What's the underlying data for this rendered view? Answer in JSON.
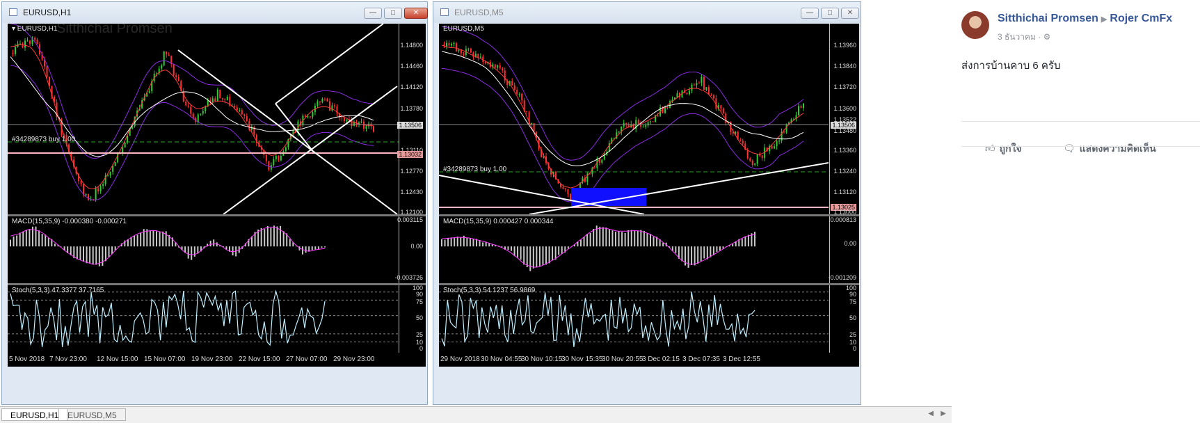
{
  "windows": [
    {
      "title": "EURUSD,H1",
      "active": true,
      "main_label": "EURUSD,H1",
      "watermark": "Sitthichai Promsen",
      "order_label": "#34289873 buy 1.00",
      "price_ticks": [
        "1.14800",
        "1.14460",
        "1.14120",
        "1.13780",
        "1.13506",
        "1.13110",
        "1.13032",
        "1.12770",
        "1.12430",
        "1.12100"
      ],
      "current_price": "1.13506",
      "order_price": "1.13032",
      "macd_label": "MACD(15,35,9) -0.000380 -0.000271",
      "macd_ticks": [
        "0.003115",
        "0.00",
        "-0.003726"
      ],
      "stoch_label": "Stoch(5,3,3) 47.3377 37.7165",
      "stoch_ticks": [
        "100",
        "90",
        "75",
        "50",
        "25",
        "10",
        "0"
      ],
      "time_labels": [
        "5 Nov 2018",
        "7 Nov 23:00",
        "12 Nov 15:00",
        "15 Nov 07:00",
        "19 Nov 23:00",
        "22 Nov 15:00",
        "27 Nov 07:00",
        "29 Nov 23:00"
      ]
    },
    {
      "title": "EURUSD,M5",
      "active": false,
      "main_label": "EURUSD,M5",
      "order_label": "#34289873 buy 1.00",
      "price_ticks": [
        "1.13960",
        "1.13840",
        "1.13720",
        "1.13600",
        "1.13522",
        "1.13506",
        "1.13480",
        "1.13360",
        "1.13240",
        "1.13120",
        "1.13025",
        "1.13000"
      ],
      "current_price": "1.13506",
      "order_price": "1.13025",
      "macd_label": "MACD(15,35,9) 0.000427 0.000344",
      "macd_ticks": [
        "0.000813",
        "0.00",
        "-0.001209"
      ],
      "stoch_label": "Stoch(5,3,3) 54.1237 56.9869",
      "stoch_ticks": [
        "100",
        "90",
        "75",
        "50",
        "25",
        "10",
        "0"
      ],
      "time_labels": [
        "29 Nov 2018",
        "30 Nov 04:55",
        "30 Nov 10:15",
        "30 Nov 15:35",
        "30 Nov 20:55",
        "3 Dec 02:15",
        "3 Dec 07:35",
        "3 Dec 12:55"
      ]
    }
  ],
  "bottom_tabs": [
    "EURUSD,H1",
    "EURUSD,M5"
  ],
  "facebook": {
    "author": "Sitthichai Promsen",
    "group": "Rojer CmFx",
    "date": "3 ธันวาคม",
    "post_text": "ส่งการบ้านคาบ 6 ครับ",
    "like_label": "ถูกใจ",
    "comment_label": "แสดงความคิดเห็น"
  },
  "colors": {
    "chart_bg": "#000000",
    "bull": "#32cd32",
    "bear": "#ff3030",
    "bollinger": "#8a2be2",
    "ma_fast": "#ff3a3a",
    "ma_slow": "#ffffff",
    "stoch": "#bfefff",
    "macd_hist": "#c8c8c8",
    "order_line": "#22aa22",
    "support_line": "#ffb6c1",
    "fb_link": "#365899"
  }
}
